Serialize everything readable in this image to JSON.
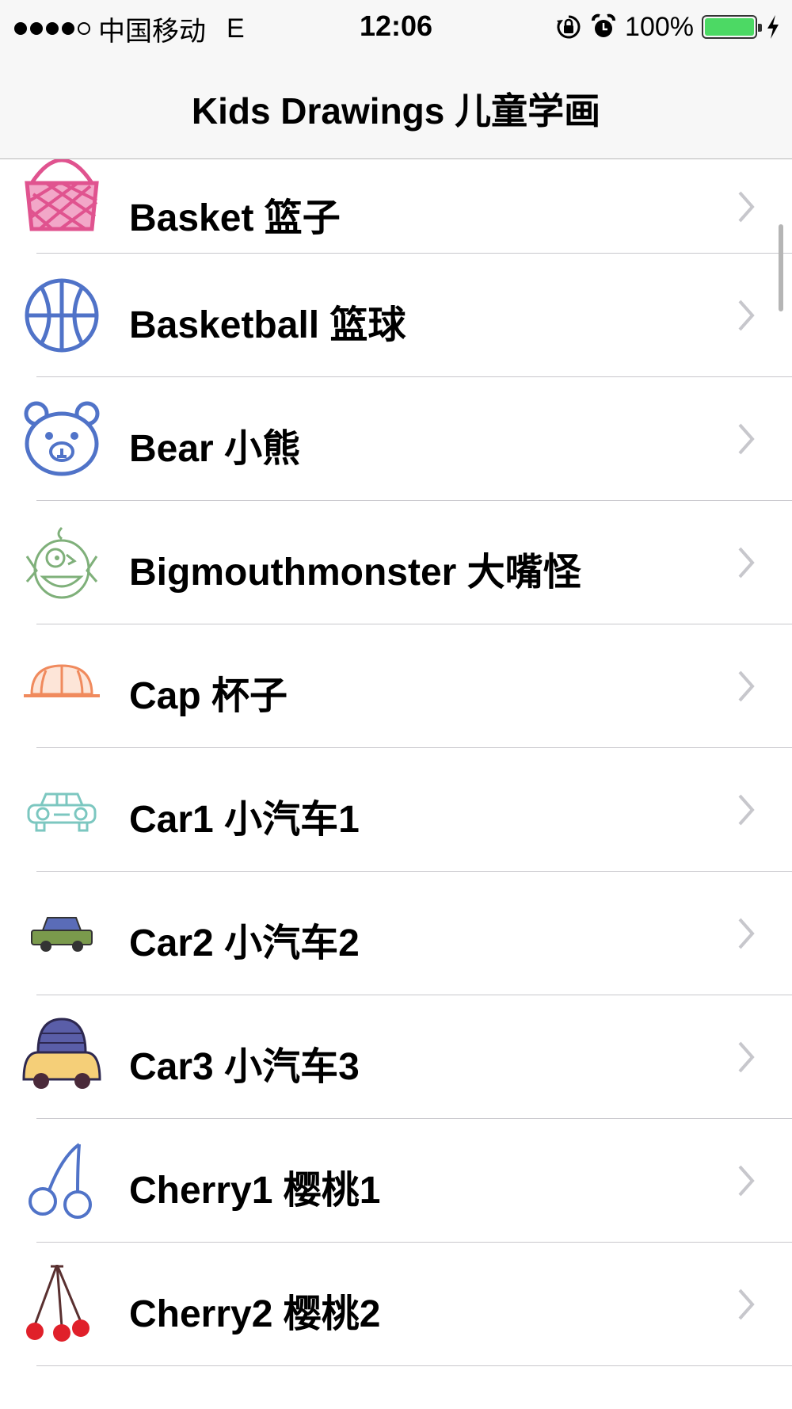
{
  "status_bar": {
    "carrier": "中国移动",
    "network": "E",
    "time": "12:06",
    "battery_percent": "100%",
    "battery_level": 1.0,
    "colors": {
      "battery": "#4cd964"
    }
  },
  "navbar": {
    "title": "Kids Drawings 儿童学画"
  },
  "items": [
    {
      "label": "Basket 篮子",
      "icon": "basket-icon",
      "color": "#e0538f"
    },
    {
      "label": "Basketball 篮球",
      "icon": "basketball-icon",
      "color": "#5073c8"
    },
    {
      "label": "Bear 小熊",
      "icon": "bear-icon",
      "color": "#5073c8"
    },
    {
      "label": "Bigmouthmonster 大嘴怪",
      "icon": "monster-icon",
      "color": "#7fb07a"
    },
    {
      "label": "Cap 杯子",
      "icon": "cap-icon",
      "color": "#f08a5d"
    },
    {
      "label": "Car1 小汽车1",
      "icon": "car1-icon",
      "color": "#7cc7c0"
    },
    {
      "label": "Car2 小汽车2",
      "icon": "car2-icon",
      "color": "#7a9a4c"
    },
    {
      "label": "Car3 小汽车3",
      "icon": "car3-icon",
      "color": "#f5cf78"
    },
    {
      "label": "Cherry1 樱桃1",
      "icon": "cherry1-icon",
      "color": "#5073c8"
    },
    {
      "label": "Cherry2 樱桃2",
      "icon": "cherry2-icon",
      "color": "#e0202a"
    }
  ]
}
